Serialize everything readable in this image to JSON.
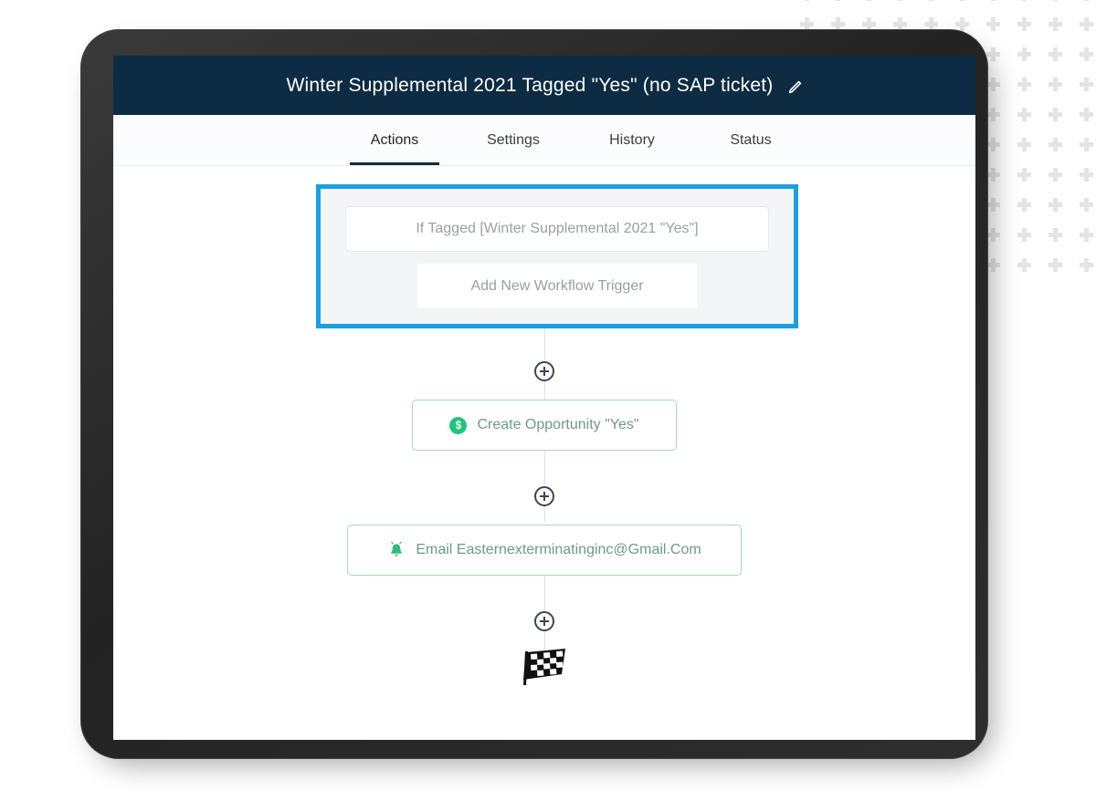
{
  "app": {
    "title": "Winter Supplemental 2021 Tagged \"Yes\" (no SAP ticket)",
    "edit_icon": "pencil-icon",
    "header_color": "#0d2c43"
  },
  "tabs": [
    {
      "label": "Actions",
      "active": true
    },
    {
      "label": "Settings",
      "active": false
    },
    {
      "label": "History",
      "active": false
    },
    {
      "label": "Status",
      "active": false
    }
  ],
  "trigger_group": {
    "highlight_color": "#1aa0e0",
    "condition_label": "If Tagged [Winter Supplemental 2021 \"Yes\"]",
    "add_trigger_label": "Add New Workflow Trigger"
  },
  "workflow": {
    "add_step_label": "+",
    "accent_green": "#22c37c",
    "nodes": [
      {
        "icon": "dollar-circle-icon",
        "icon_glyph": "$",
        "label": "Create Opportunity \"Yes\""
      },
      {
        "icon": "bell-icon",
        "icon_glyph": "",
        "label": "Email Easternexterminatinginc@Gmail.Com"
      }
    ],
    "end_marker": "checkered-flag-icon"
  },
  "decoration": {
    "pattern": "plus-grid",
    "pattern_color": "#e4e4e4",
    "columns": 10,
    "rows": 10
  }
}
